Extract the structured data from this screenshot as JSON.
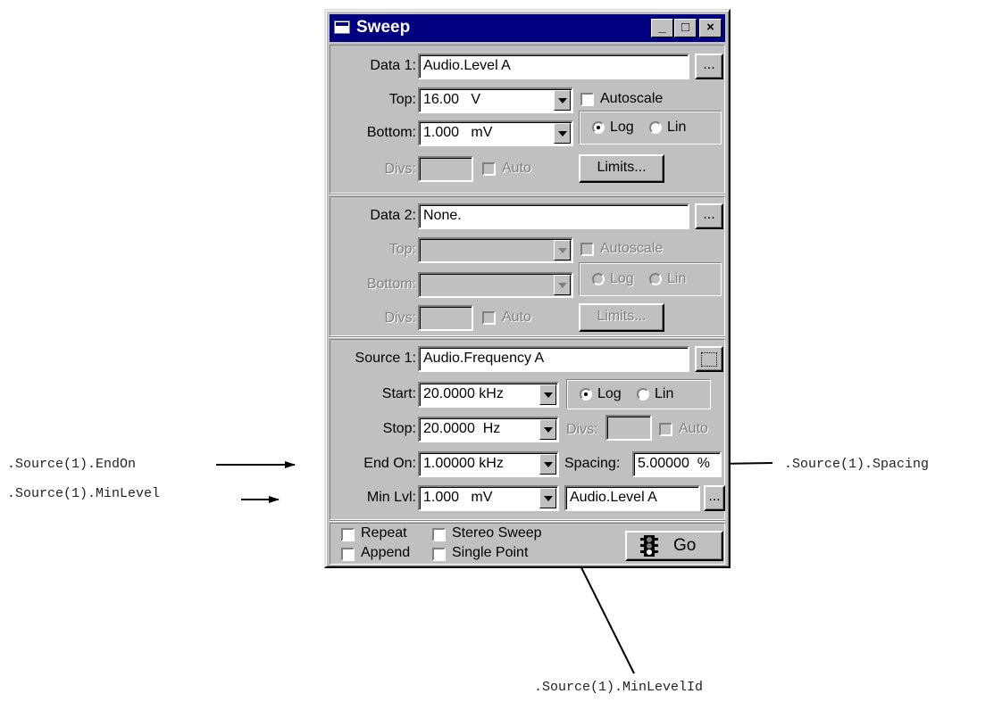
{
  "window": {
    "title": "Sweep",
    "min_btn": "_",
    "max_btn": "□",
    "close_btn": "×"
  },
  "data1": {
    "label": "Data 1:",
    "value": "Audio.Level A",
    "browse": "...",
    "top_label": "Top:",
    "top_value": "16.00   V",
    "bottom_label": "Bottom:",
    "bottom_value": "1.000   mV",
    "autoscale": "Autoscale",
    "log": "Log",
    "lin": "Lin",
    "divs_label": "Divs:",
    "auto": "Auto",
    "limits": "Limits..."
  },
  "data2": {
    "label": "Data 2:",
    "value": "None.",
    "browse": "...",
    "top_label": "Top:",
    "bottom_label": "Bottom:",
    "autoscale": "Autoscale",
    "log": "Log",
    "lin": "Lin",
    "divs_label": "Divs:",
    "auto": "Auto",
    "limits": "Limits..."
  },
  "source1": {
    "label": "Source 1:",
    "value": "Audio.Frequency A",
    "start_label": "Start:",
    "start_value": "20.0000 kHz",
    "stop_label": "Stop:",
    "stop_value": "20.0000  Hz",
    "endon_label": "End On:",
    "endon_value": "1.00000 kHz",
    "minlvl_label": "Min Lvl:",
    "minlvl_value": "1.000   mV",
    "log": "Log",
    "lin": "Lin",
    "divs_label": "Divs:",
    "auto": "Auto",
    "spacing_label": "Spacing:",
    "spacing_value": "5.00000  %",
    "minlevel_id_value": "Audio.Level A",
    "browse": "..."
  },
  "options": {
    "repeat": "Repeat",
    "append": "Append",
    "stereo_sweep": "Stereo Sweep",
    "single_point": "Single Point",
    "go": "Go"
  },
  "annotations": {
    "endon": ".Source(1).EndOn",
    "minlevel": ".Source(1).MinLevel",
    "spacing": ".Source(1).Spacing",
    "minlevelid": ".Source(1).MinLevelId"
  }
}
